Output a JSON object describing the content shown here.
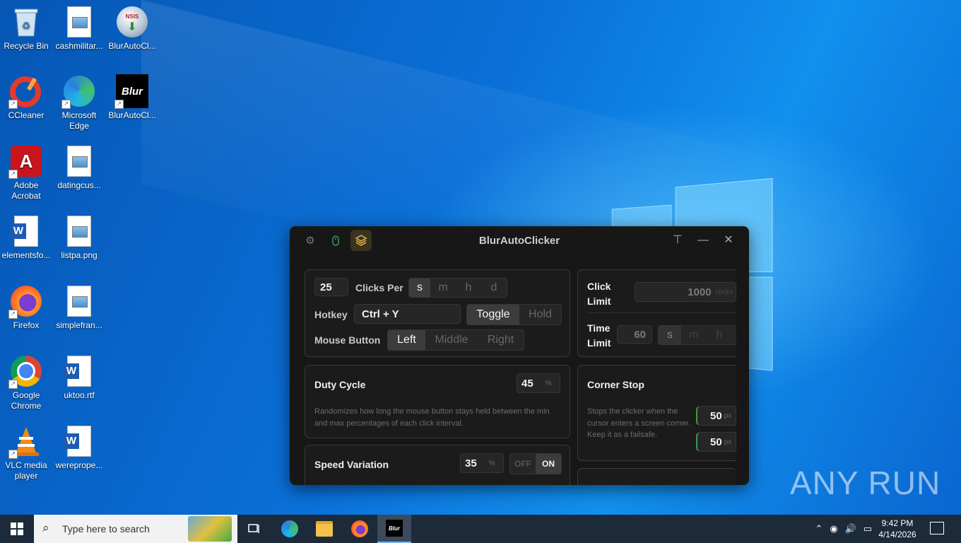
{
  "desktop": {
    "icons": [
      {
        "label": "Recycle Bin"
      },
      {
        "label": "cashmilitar..."
      },
      {
        "label": "BlurAutoCl..."
      },
      {
        "label": "CCleaner"
      },
      {
        "label": "Microsoft Edge"
      },
      {
        "label": "BlurAutoCl..."
      },
      {
        "label": "Adobe Acrobat"
      },
      {
        "label": "datingcus..."
      },
      {
        "label": "elementsfo..."
      },
      {
        "label": "listpa.png"
      },
      {
        "label": "Firefox"
      },
      {
        "label": "simplefran..."
      },
      {
        "label": "Google Chrome"
      },
      {
        "label": "uktoo.rtf"
      },
      {
        "label": "VLC media player"
      },
      {
        "label": "wereprope..."
      }
    ],
    "installer_badge": "NSIS",
    "blur_logo": "Blur"
  },
  "app": {
    "title": "BlurAutoClicker",
    "clicks": {
      "value": "25",
      "label": "Clicks Per",
      "units": [
        "s",
        "m",
        "h",
        "d"
      ],
      "selected": "s"
    },
    "hotkey": {
      "label": "Hotkey",
      "value": "Ctrl + Y",
      "modes": [
        "Toggle",
        "Hold"
      ],
      "selected": "Toggle"
    },
    "mouse_button": {
      "label": "Mouse Button",
      "options": [
        "Left",
        "Middle",
        "Right"
      ],
      "selected": "Left"
    },
    "click_limit": {
      "label_line1": "Click",
      "label_line2": "Limit",
      "value": "1000",
      "unit": "clicks"
    },
    "time_limit": {
      "label_line1": "Time",
      "label_line2": "Limit",
      "value": "60",
      "units": [
        "s",
        "m",
        "h"
      ],
      "selected": "s"
    },
    "duty_cycle": {
      "label": "Duty Cycle",
      "value": "45",
      "unit": "%",
      "description": "Randomizes how long the mouse button stays held between the min and max percentages of each click interval."
    },
    "corner_stop": {
      "label": "Corner Stop",
      "description": "Stops the clicker when the cursor enters a screen corner. Keep it as a failsafe.",
      "value1": "50",
      "value2": "50",
      "unit": "px"
    },
    "speed_variation": {
      "label": "Speed Variation",
      "value": "35",
      "unit": "%",
      "off": "OFF",
      "on": "ON"
    }
  },
  "taskbar": {
    "search_placeholder": "Type here to search",
    "blur_label": "Blur",
    "time": "9:42 PM",
    "date": "4/14/2026"
  },
  "watermark": "ANY RUN"
}
